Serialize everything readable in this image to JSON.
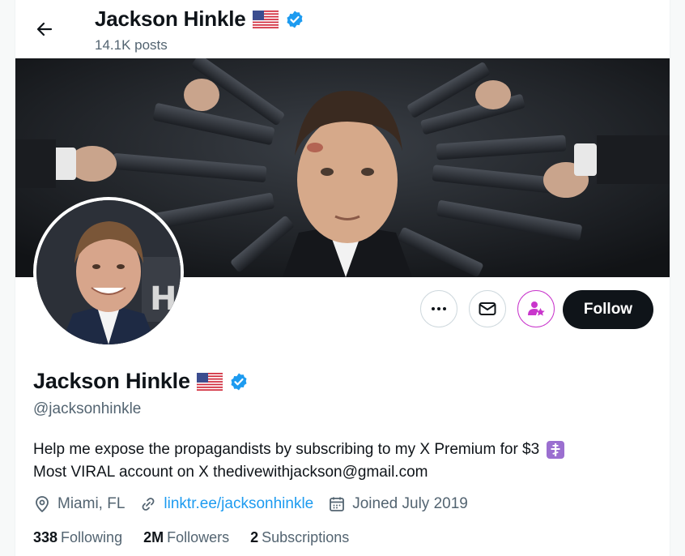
{
  "header": {
    "name": "Jackson Hinkle",
    "posts": "14.1K posts"
  },
  "profile": {
    "name": "Jackson Hinkle",
    "handle": "@jacksonhinkle",
    "bio_line1": "Help me expose the propagandists by subscribing to my X Premium for $3",
    "bio_line2": "Most VIRAL account on X  thedivewithjackson@gmail.com",
    "location": "Miami, FL",
    "link": "linktr.ee/jacksonhinkle",
    "joined": "Joined July 2019"
  },
  "stats": {
    "following_count": "338",
    "following_label": "Following",
    "followers_count": "2M",
    "followers_label": "Followers",
    "subscriptions_count": "2",
    "subscriptions_label": "Subscriptions"
  },
  "actions": {
    "follow_label": "Follow"
  },
  "icons": {
    "back": "arrow-left-icon",
    "more": "more-icon",
    "message": "envelope-icon",
    "subscribe": "subscribe-star-icon",
    "verified": "verified-badge-icon",
    "flag": "us-flag-icon",
    "location": "location-pin-icon",
    "link": "link-icon",
    "calendar": "calendar-icon",
    "cross": "orthodox-cross-icon"
  },
  "colors": {
    "accent": "#1d9bf0",
    "subscribe": "#c936cc",
    "follow_bg": "#0f1419",
    "muted": "#536471"
  }
}
